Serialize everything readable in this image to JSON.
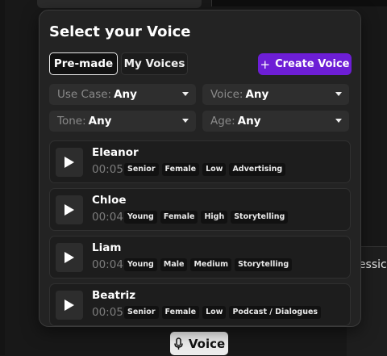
{
  "background": {
    "right_text": "fessic",
    "voice_chip_label": "Voice"
  },
  "modal": {
    "title": "Select your Voice",
    "tabs": [
      {
        "label": "Pre-made",
        "active": true
      },
      {
        "label": "My Voices",
        "active": false
      }
    ],
    "create_button": {
      "icon": "plus-icon",
      "label": "Create Voice"
    },
    "accent_color": "#6d1ed6",
    "filters": [
      {
        "label": "Use Case:",
        "value": "Any"
      },
      {
        "label": "Voice:",
        "value": "Any"
      },
      {
        "label": "Tone:",
        "value": "Any"
      },
      {
        "label": "Age:",
        "value": "Any"
      }
    ],
    "voices": [
      {
        "name": "Eleanor",
        "duration": "00:05",
        "tags": [
          "Senior",
          "Female",
          "Low",
          "Advertising"
        ]
      },
      {
        "name": "Chloe",
        "duration": "00:04",
        "tags": [
          "Young",
          "Female",
          "High",
          "Storytelling"
        ]
      },
      {
        "name": "Liam",
        "duration": "00:04",
        "tags": [
          "Young",
          "Male",
          "Medium",
          "Storytelling"
        ]
      },
      {
        "name": "Beatriz",
        "duration": "00:05",
        "tags": [
          "Senior",
          "Female",
          "Low",
          "Podcast / Dialogues"
        ]
      }
    ]
  }
}
